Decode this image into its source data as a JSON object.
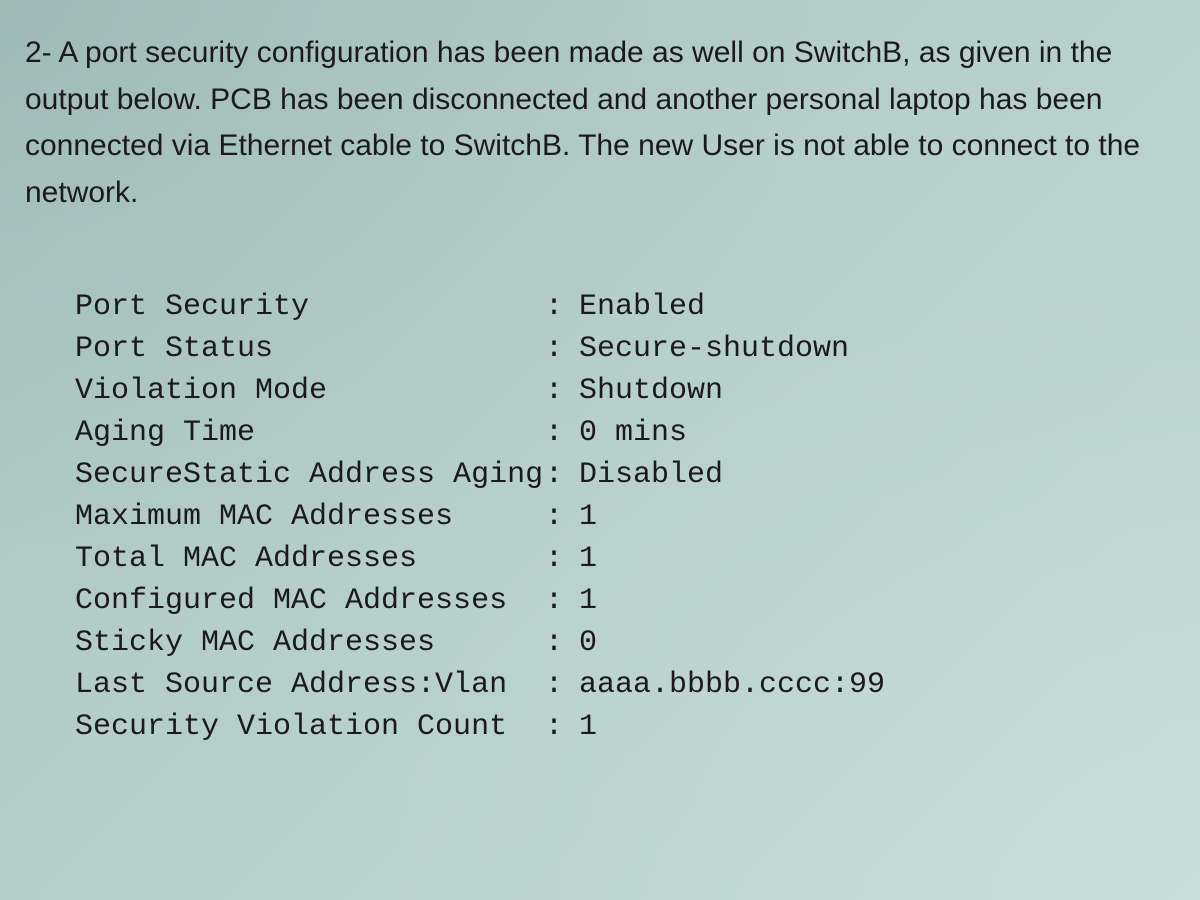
{
  "question": {
    "text": "2- A port security configuration has been made as well on SwitchB, as given in the output below. PCB has been disconnected and another personal laptop has been connected via Ethernet cable to SwitchB. The new User is not able to connect to the network."
  },
  "output": {
    "rows": [
      {
        "label": "Port Security",
        "value": "Enabled"
      },
      {
        "label": "Port Status",
        "value": "Secure-shutdown"
      },
      {
        "label": "Violation Mode",
        "value": "Shutdown"
      },
      {
        "label": "Aging Time",
        "value": "0 mins"
      },
      {
        "label": "SecureStatic Address Aging",
        "value": "Disabled"
      },
      {
        "label": "Maximum MAC Addresses",
        "value": "1"
      },
      {
        "label": "Total MAC Addresses",
        "value": "1"
      },
      {
        "label": "Configured MAC Addresses",
        "value": "1"
      },
      {
        "label": "Sticky MAC Addresses",
        "value": "0"
      },
      {
        "label": "Last Source Address:Vlan",
        "value": "aaaa.bbbb.cccc:99"
      },
      {
        "label": "Security Violation Count",
        "value": "1"
      }
    ]
  }
}
